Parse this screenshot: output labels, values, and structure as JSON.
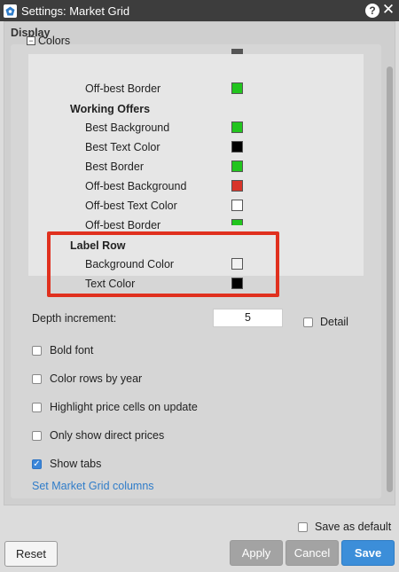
{
  "window": {
    "title": "Settings: Market Grid",
    "help_icon": "help-icon",
    "close_icon": "close-icon"
  },
  "section": {
    "title": "Display"
  },
  "colors_group": {
    "label": "Colors",
    "collapse_symbol": "−",
    "rows": [
      {
        "type": "item",
        "label": "Off-best Border",
        "color": "#22c51e"
      },
      {
        "type": "group",
        "label": "Working Offers"
      },
      {
        "type": "item",
        "label": "Best Background",
        "color": "#22c51e"
      },
      {
        "type": "item",
        "label": "Best Text Color",
        "color": "#000000"
      },
      {
        "type": "item",
        "label": "Best Border",
        "color": "#22c51e"
      },
      {
        "type": "item",
        "label": "Off-best Background",
        "color": "#d8352a"
      },
      {
        "type": "item",
        "label": "Off-best Text Color",
        "color": "#ffffff"
      },
      {
        "type": "item",
        "label": "Off-best Border",
        "color": "#22c51e"
      },
      {
        "type": "group",
        "label": "Label Row"
      },
      {
        "type": "item",
        "label": "Background Color",
        "color": "#f2f2f2"
      },
      {
        "type": "item",
        "label": "Text Color",
        "color": "#000000"
      }
    ]
  },
  "depth": {
    "label": "Depth increment:",
    "value": "5",
    "detail_label": "Detail",
    "detail_checked": false
  },
  "options": [
    {
      "label": "Bold font",
      "checked": false
    },
    {
      "label": "Color rows by year",
      "checked": false
    },
    {
      "label": "Highlight price cells on update",
      "checked": false
    },
    {
      "label": "Only show direct prices",
      "checked": false
    },
    {
      "label": "Show tabs",
      "checked": true
    }
  ],
  "link": {
    "label": "Set Market Grid columns"
  },
  "footer": {
    "save_default_label": "Save as default",
    "save_default_checked": false,
    "reset_label": "Reset",
    "apply_label": "Apply",
    "cancel_label": "Cancel",
    "save_label": "Save"
  },
  "colors": {
    "accent": "#3c8ed9",
    "highlight": "#e0301e",
    "titlebar": "#3d3d3d"
  }
}
